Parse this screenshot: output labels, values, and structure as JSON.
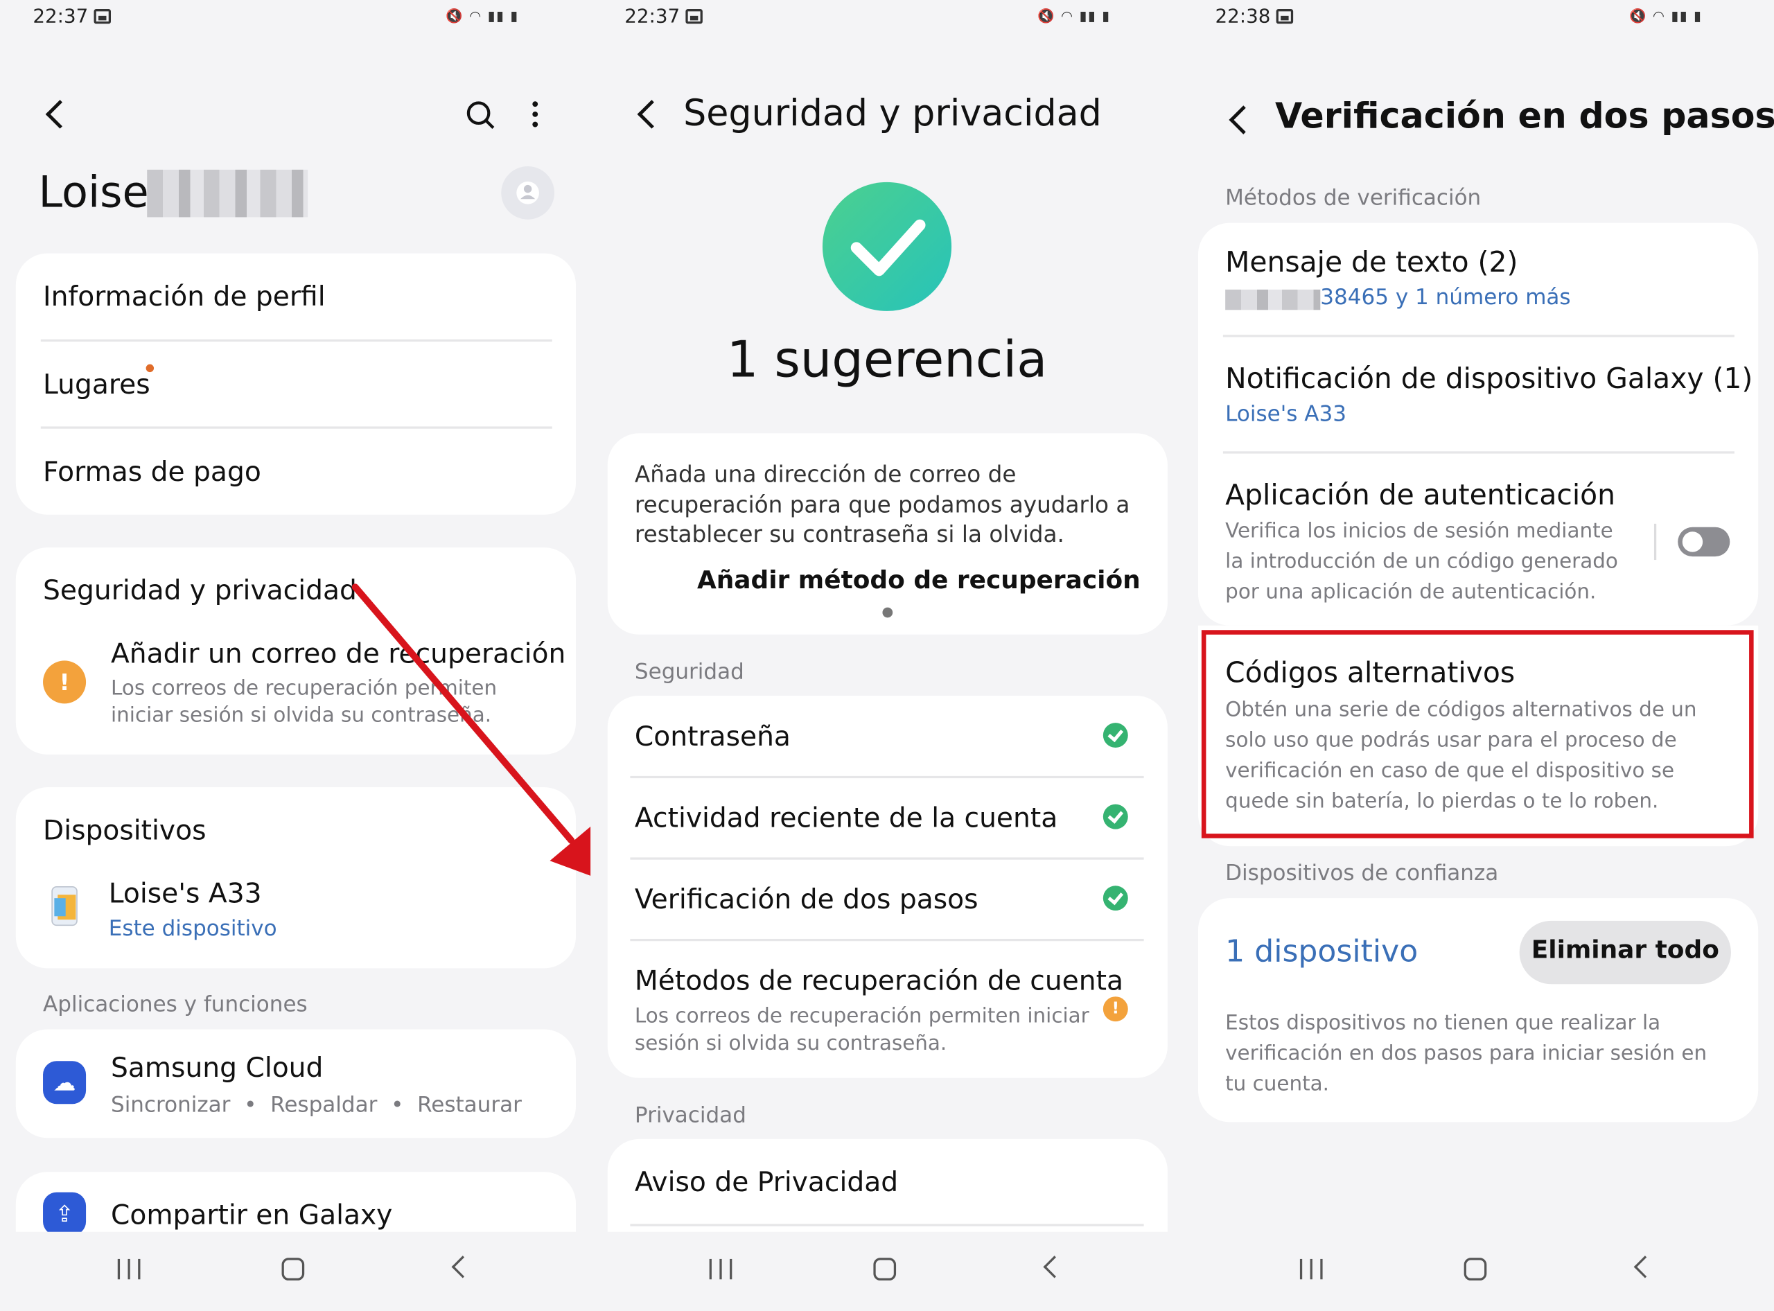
{
  "screen1": {
    "status": {
      "time": "22:37"
    },
    "profile": {
      "name": "Loise"
    },
    "profile_card": {
      "items": [
        "Información de perfil",
        "Lugares",
        "Formas de pago"
      ]
    },
    "security_card": {
      "title": "Seguridad y privacidad",
      "alert_title": "Añadir un correo de recuperación",
      "alert_desc_1": "Los correos de recuperación permiten",
      "alert_desc_2": "iniciar sesión si olvida su contraseña."
    },
    "devices_card": {
      "title": "Dispositivos",
      "device_name": "Loise's A33",
      "device_sub": "Este dispositivo"
    },
    "apps_section": {
      "label": "Aplicaciones y funciones"
    },
    "cloud": {
      "title": "Samsung Cloud",
      "sub_1": "Sincronizar",
      "sub_2": "Respaldar",
      "sub_3": "Restaurar"
    },
    "share": {
      "title": "Compartir en Galaxy"
    }
  },
  "screen2": {
    "status": {
      "time": "22:37"
    },
    "header": {
      "title": "Seguridad y privacidad"
    },
    "hero": {
      "title": "1 sugerencia"
    },
    "suggestion": {
      "line_1": "Añada una dirección de correo de",
      "line_2": "recuperación para que podamos ayudarlo a",
      "line_3": "restablecer su contraseña si la olvida.",
      "action": "Añadir método de recuperación"
    },
    "security_section": {
      "label": "Seguridad"
    },
    "security_items": {
      "password": "Contraseña",
      "activity": "Actividad reciente de la cuenta",
      "two_step": "Verificación de dos pasos",
      "recovery": "Métodos de recuperación de cuenta",
      "recovery_desc_1": "Los correos de recuperación permiten iniciar",
      "recovery_desc_2": "sesión si olvida su contraseña."
    },
    "privacy_section": {
      "label": "Privacidad"
    },
    "privacy_items": {
      "notice": "Aviso de Privacidad"
    }
  },
  "screen3": {
    "status": {
      "time": "22:38"
    },
    "header": {
      "title": "Verificación en dos pasos"
    },
    "methods_section": {
      "label": "Métodos de verificación"
    },
    "sms": {
      "title": "Mensaje de texto (2)",
      "sub": "38465 y 1 número más"
    },
    "galaxy": {
      "title": "Notificación de dispositivo Galaxy (1)",
      "sub": "Loise's A33"
    },
    "auth_app": {
      "title": "Aplicación de autenticación",
      "desc_1": "Verifica los inicios de sesión mediante",
      "desc_2": "la introducción de un código generado",
      "desc_3": "por una aplicación de autenticación."
    },
    "backup": {
      "title": "Códigos alternativos",
      "desc_1": "Obtén una serie de códigos alternativos de un",
      "desc_2": "solo uso que podrás usar para el proceso de",
      "desc_3": "verificación en caso de que el dispositivo se",
      "desc_4": "quede sin batería, lo pierdas o te lo roben."
    },
    "trusted_section": {
      "label": "Dispositivos de confianza"
    },
    "trusted": {
      "count": "1 dispositivo",
      "remove_all": "Eliminar todo",
      "desc_1": "Estos dispositivos no tienen que realizar la",
      "desc_2": "verificación en dos pasos para iniciar sesión en",
      "desc_3": "tu cuenta."
    }
  },
  "colors": {
    "accent_blue": "#3a6fb7",
    "highlight_red": "#d8141c",
    "ok_green": "#35b371",
    "warn_orange": "#f3a23c"
  }
}
